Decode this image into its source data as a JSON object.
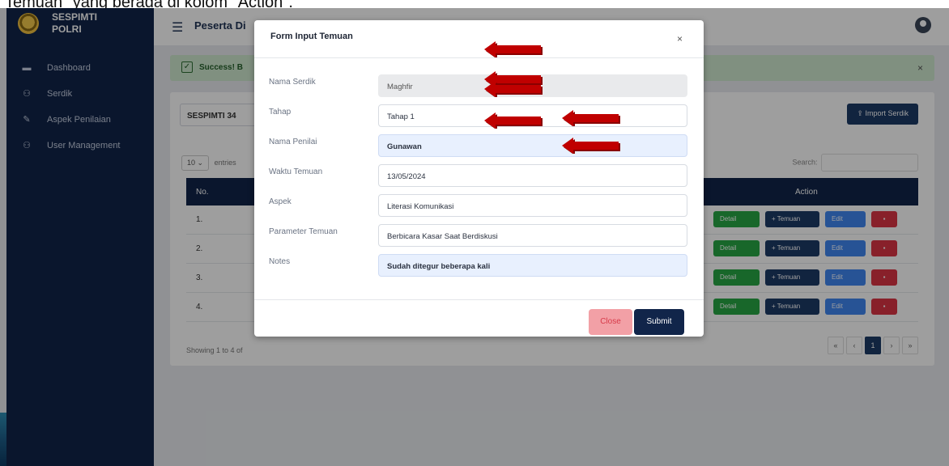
{
  "caption": "Temuan\" yang berada di kolom \"Action\".",
  "sidebar": {
    "brand_line1": "SESPIMTI",
    "brand_line2": "POLRI",
    "items": [
      {
        "label": "Dashboard",
        "icon": "dashboard-icon"
      },
      {
        "label": "Serdik",
        "icon": "users-icon"
      },
      {
        "label": "Aspek Penilaian",
        "icon": "pen-icon"
      },
      {
        "label": "User Management",
        "icon": "users-icon"
      }
    ]
  },
  "topbar": {
    "title": "Peserta Di"
  },
  "alert": {
    "message": "Success! B",
    "close": "×"
  },
  "filter": {
    "selected": "SESPIMTI 34"
  },
  "import_button": "Import Serdik",
  "length": {
    "value": "10",
    "suffix": "entries"
  },
  "search_label": "Search:",
  "table": {
    "headers": {
      "no": "No.",
      "action": "Action"
    },
    "rows": [
      "1.",
      "2.",
      "3.",
      "4."
    ],
    "buttons": {
      "detail": "Detail",
      "temuan": "+ Temuan",
      "edit": "Edit"
    }
  },
  "footer_info": "Showing 1 to 4 of",
  "pager": [
    "«",
    "‹",
    "1",
    "›",
    "»"
  ],
  "modal": {
    "title": "Form Input Temuan",
    "close": "×",
    "fields": [
      {
        "label": "Nama Serdik",
        "value": "Maghfir"
      },
      {
        "label": "Tahap",
        "value": "Tahap 1"
      },
      {
        "label": "Nama Penilai",
        "value": "Gunawan"
      },
      {
        "label": "Waktu Temuan",
        "value": "13/05/2024"
      },
      {
        "label": "Aspek",
        "value": "Literasi Komunikasi"
      },
      {
        "label": "Parameter Temuan",
        "value": "Berbicara Kasar Saat Berdiskusi"
      },
      {
        "label": "Notes",
        "value": "Sudah ditegur beberapa kali"
      }
    ],
    "close_button": "Close",
    "submit_button": "Submit"
  },
  "colors": {
    "sidebar": "#11254a",
    "accent": "#11254a",
    "arrow": "#c00000"
  }
}
